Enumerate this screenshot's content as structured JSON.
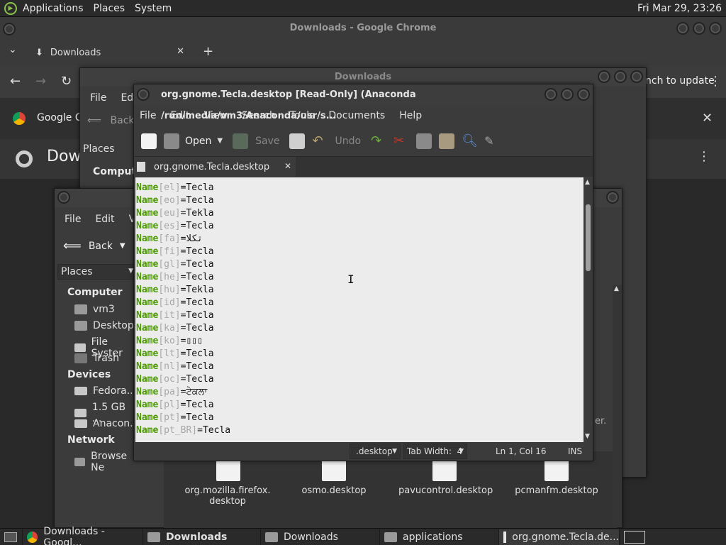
{
  "top_panel": {
    "menus": [
      "Applications",
      "Places",
      "System"
    ],
    "clock": "Fri Mar 29, 23:26"
  },
  "chrome": {
    "title": "Downloads - Google Chrome",
    "tab_label": "Downloads",
    "relaunch_text": "nch to update",
    "bookmark_text": "Google Cl",
    "page_heading": "Dow"
  },
  "fm_back_window": {
    "title": "Downloads",
    "menu": [
      "File",
      "Edi"
    ],
    "back_label": "Back",
    "places_label": "Places",
    "computer_label": "Compute",
    "item_partial": "vm3"
  },
  "fm_front_window": {
    "menu": [
      "File",
      "Edit",
      "Vi"
    ],
    "back_label": "Back",
    "places_label": "Places",
    "sections": {
      "computer": "Computer",
      "devices": "Devices",
      "network": "Network"
    },
    "computer_items": [
      "vm3",
      "Desktop",
      "File Syster",
      "Trash"
    ],
    "device_items": [
      "Fedora...",
      "1.5 GB ...",
      "Anacon..."
    ],
    "network_items": [
      "Browse Ne"
    ],
    "side_fragment": "er.",
    "files": [
      {
        "name": "org.mozilla.firefox.\ndesktop"
      },
      {
        "name": "osmo.desktop"
      },
      {
        "name": "pavucontrol.desktop"
      },
      {
        "name": "pcmanfm.desktop"
      }
    ]
  },
  "gedit": {
    "title": "org.gnome.Tecla.desktop [Read-Only] (Anaconda /run/media/vm3/Anaconda/usr/s...",
    "menu": [
      "File",
      "Edit",
      "View",
      "Search",
      "Tools",
      "Documents",
      "Help"
    ],
    "toolbar": {
      "open": "Open",
      "save": "Save",
      "undo": "Undo"
    },
    "doc_tab": "org.gnome.Tecla.desktop",
    "lines": [
      {
        "key": "Name",
        "lang": "el",
        "val": "Tecla"
      },
      {
        "key": "Name",
        "lang": "eo",
        "val": "Tecla"
      },
      {
        "key": "Name",
        "lang": "eu",
        "val": "Tekla"
      },
      {
        "key": "Name",
        "lang": "es",
        "val": "Tecla"
      },
      {
        "key": "Name",
        "lang": "fa",
        "val": "تکلا"
      },
      {
        "key": "Name",
        "lang": "fi",
        "val": "Tecla"
      },
      {
        "key": "Name",
        "lang": "gl",
        "val": "Tecla"
      },
      {
        "key": "Name",
        "lang": "he",
        "val": "Tecla"
      },
      {
        "key": "Name",
        "lang": "hu",
        "val": "Tekla"
      },
      {
        "key": "Name",
        "lang": "id",
        "val": "Tecla"
      },
      {
        "key": "Name",
        "lang": "it",
        "val": "Tecla"
      },
      {
        "key": "Name",
        "lang": "ka",
        "val": "Tecla"
      },
      {
        "key": "Name",
        "lang": "ko",
        "val": "▯▯▯"
      },
      {
        "key": "Name",
        "lang": "lt",
        "val": "Tecla"
      },
      {
        "key": "Name",
        "lang": "nl",
        "val": "Tecla"
      },
      {
        "key": "Name",
        "lang": "oc",
        "val": "Tecla"
      },
      {
        "key": "Name",
        "lang": "pa",
        "val": "ਟੇਕਲਾ"
      },
      {
        "key": "Name",
        "lang": "pl",
        "val": "Tecla"
      },
      {
        "key": "Name",
        "lang": "pt",
        "val": "Tecla"
      },
      {
        "key": "Name",
        "lang": "pt_BR",
        "val": "Tecla"
      }
    ],
    "status": {
      "syntax": ".desktop",
      "tab_width": "Tab Width:  4",
      "position": "Ln 1, Col 16",
      "mode": "INS"
    }
  },
  "taskbar": {
    "items": [
      "Downloads - Googl...",
      "Downloads",
      "Downloads",
      "applications",
      "org.gnome.Tecla.de..."
    ]
  }
}
